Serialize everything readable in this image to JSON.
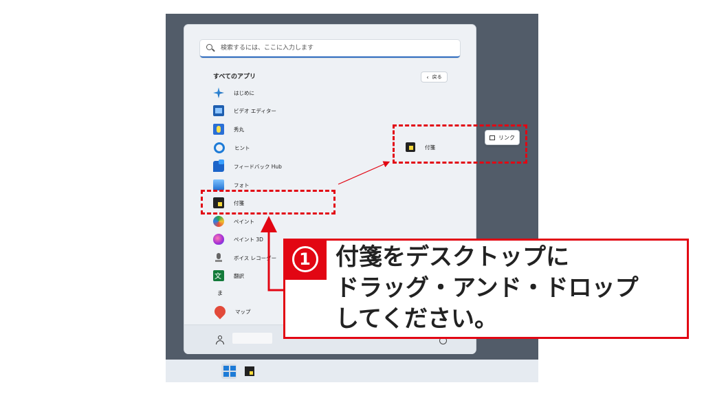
{
  "search": {
    "placeholder": "検索するには、ここに入力します"
  },
  "all_apps": {
    "title": "すべてのアプリ",
    "back_label": "戻る",
    "apps": [
      {
        "label": "はじめに",
        "icon": "getstarted-icon"
      },
      {
        "label": "ビデオ エディター",
        "icon": "video-editor-icon"
      },
      {
        "label": "秀丸",
        "icon": "hidemaru-icon"
      },
      {
        "label": "ヒント",
        "icon": "tips-icon"
      },
      {
        "label": "フィードバック Hub",
        "icon": "feedback-hub-icon"
      },
      {
        "label": "フォト",
        "icon": "photos-icon"
      },
      {
        "label": "付箋",
        "icon": "sticky-notes-icon"
      },
      {
        "label": "ペイント",
        "icon": "paint-icon"
      },
      {
        "label": "ペイント 3D",
        "icon": "paint3d-icon"
      },
      {
        "label": "ボイス レコーダー",
        "icon": "voice-recorder-icon"
      },
      {
        "label": "翻訳",
        "icon": "translator-icon"
      }
    ],
    "letter_ma": "ま",
    "apps_ma": [
      {
        "label": "マップ",
        "icon": "maps-icon"
      }
    ]
  },
  "drag": {
    "item_label": "付箋",
    "link_label": "リンク"
  },
  "callout": {
    "step": "1",
    "lines": [
      "付箋をデスクトップに",
      "ドラッグ・アンド・ドロップ",
      "してください。"
    ]
  },
  "colors": {
    "accent_red": "#e20613",
    "desktop": "#525c69",
    "start_bg": "#eef1f5",
    "windows_blue": "#1d7bd7"
  }
}
